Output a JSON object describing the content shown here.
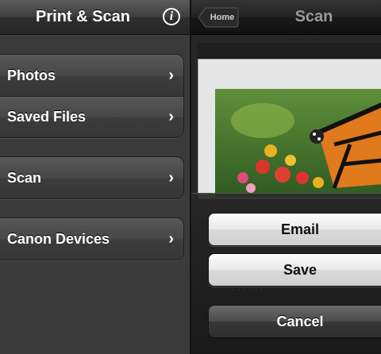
{
  "left_pane": {
    "nav_title": "Print & Scan",
    "info_icon_glyph": "i",
    "menu_groups": [
      [
        {
          "label": "Photos"
        },
        {
          "label": "Saved Files"
        }
      ],
      [
        {
          "label": "Scan"
        }
      ],
      [
        {
          "label": "Canon Devices"
        }
      ]
    ],
    "chevron_glyph": "›"
  },
  "right_pane": {
    "home_button_label": "Home",
    "nav_title": "Scan",
    "action_sheet": {
      "email_label": "Email",
      "save_label": "Save",
      "cancel_label": "Cancel"
    }
  },
  "colors": {
    "panel_background": "#3a3a3a",
    "light_button": "#e9e9e9",
    "dark_button": "#3a3a3a"
  }
}
